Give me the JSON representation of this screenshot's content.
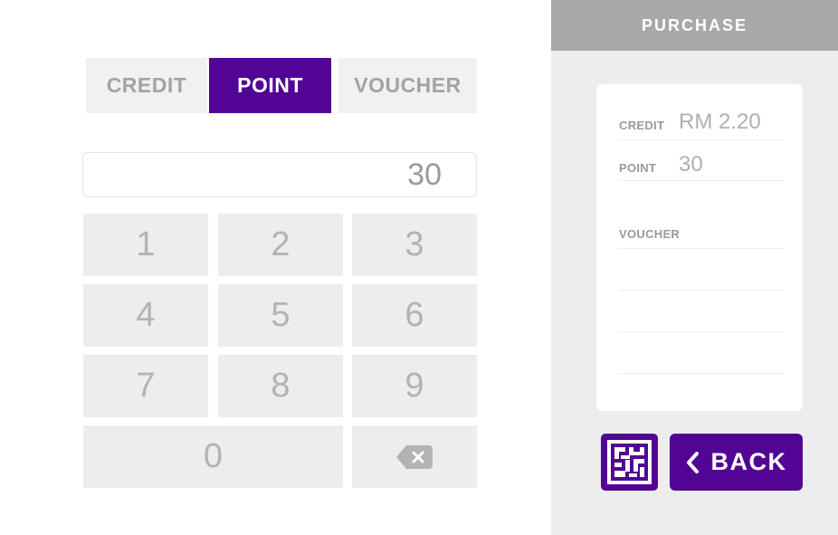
{
  "tabs": {
    "credit": "CREDIT",
    "point": "POINT",
    "voucher": "VOUCHER",
    "active": "point"
  },
  "amount": {
    "value": "30"
  },
  "keypad": {
    "k1": "1",
    "k2": "2",
    "k3": "3",
    "k4": "4",
    "k5": "5",
    "k6": "6",
    "k7": "7",
    "k8": "8",
    "k9": "9",
    "k0": "0",
    "backspace_icon": "backspace-icon"
  },
  "purchase": {
    "title": "PURCHASE",
    "credit_label": "CREDIT",
    "credit_value": "RM 2.20",
    "point_label": "POINT",
    "point_value": "30",
    "voucher_label": "VOUCHER"
  },
  "actions": {
    "qr_icon": "qr-code-icon",
    "back_label": "BACK",
    "back_icon": "chevron-left-icon"
  },
  "colors": {
    "accent": "#520594",
    "panel_bg": "#ededee",
    "header_bg": "#a8a8aa"
  }
}
